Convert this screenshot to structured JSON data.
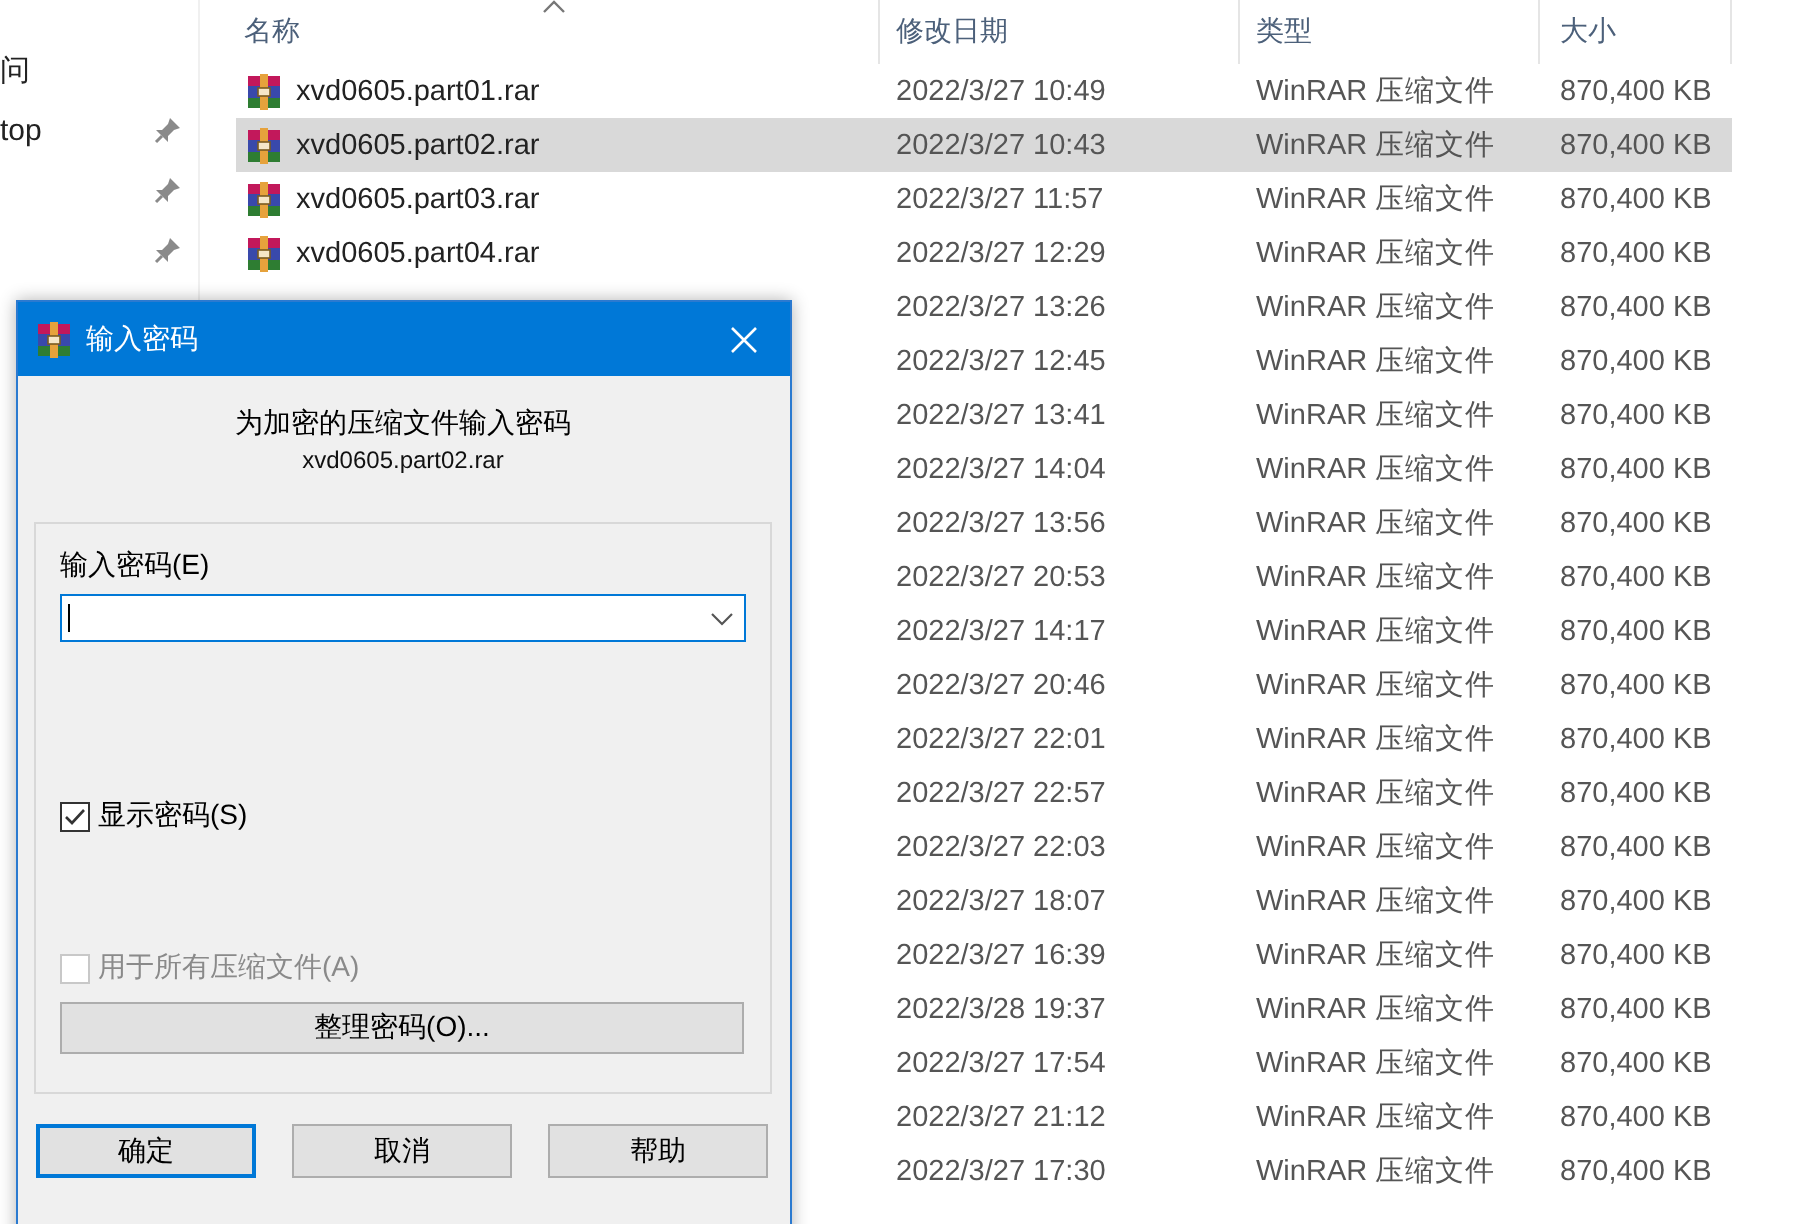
{
  "explorer": {
    "sidebar": {
      "items": [
        {
          "label": "问",
          "pinned": false
        },
        {
          "label": "top",
          "pinned": true
        },
        {
          "pinned": true
        },
        {
          "pinned": true
        }
      ]
    },
    "file_list": {
      "columns": [
        {
          "label": "名称",
          "sorted": true
        },
        {
          "label": "修改日期",
          "sorted": false
        },
        {
          "label": "类型",
          "sorted": false
        },
        {
          "label": "大小",
          "sorted": false
        }
      ],
      "rows": [
        {
          "name": "xvd0605.part01.rar",
          "date": "2022/3/27 10:49",
          "type": "WinRAR 压缩文件",
          "size": "870,400 KB",
          "selected": false
        },
        {
          "name": "xvd0605.part02.rar",
          "date": "2022/3/27 10:43",
          "type": "WinRAR 压缩文件",
          "size": "870,400 KB",
          "selected": true
        },
        {
          "name": "xvd0605.part03.rar",
          "date": "2022/3/27 11:57",
          "type": "WinRAR 压缩文件",
          "size": "870,400 KB",
          "selected": false
        },
        {
          "name": "xvd0605.part04.rar",
          "date": "2022/3/27 12:29",
          "type": "WinRAR 压缩文件",
          "size": "870,400 KB",
          "selected": false
        },
        {
          "date": "2022/3/27 13:26",
          "type": "WinRAR 压缩文件",
          "size": "870,400 KB",
          "selected": false
        },
        {
          "date": "2022/3/27 12:45",
          "type": "WinRAR 压缩文件",
          "size": "870,400 KB",
          "selected": false
        },
        {
          "date": "2022/3/27 13:41",
          "type": "WinRAR 压缩文件",
          "size": "870,400 KB",
          "selected": false
        },
        {
          "date": "2022/3/27 14:04",
          "type": "WinRAR 压缩文件",
          "size": "870,400 KB",
          "selected": false
        },
        {
          "date": "2022/3/27 13:56",
          "type": "WinRAR 压缩文件",
          "size": "870,400 KB",
          "selected": false
        },
        {
          "date": "2022/3/27 20:53",
          "type": "WinRAR 压缩文件",
          "size": "870,400 KB",
          "selected": false
        },
        {
          "date": "2022/3/27 14:17",
          "type": "WinRAR 压缩文件",
          "size": "870,400 KB",
          "selected": false
        },
        {
          "date": "2022/3/27 20:46",
          "type": "WinRAR 压缩文件",
          "size": "870,400 KB",
          "selected": false
        },
        {
          "date": "2022/3/27 22:01",
          "type": "WinRAR 压缩文件",
          "size": "870,400 KB",
          "selected": false
        },
        {
          "date": "2022/3/27 22:57",
          "type": "WinRAR 压缩文件",
          "size": "870,400 KB",
          "selected": false
        },
        {
          "date": "2022/3/27 22:03",
          "type": "WinRAR 压缩文件",
          "size": "870,400 KB",
          "selected": false
        },
        {
          "date": "2022/3/27 18:07",
          "type": "WinRAR 压缩文件",
          "size": "870,400 KB",
          "selected": false
        },
        {
          "date": "2022/3/27 16:39",
          "type": "WinRAR 压缩文件",
          "size": "870,400 KB",
          "selected": false
        },
        {
          "date": "2022/3/28 19:37",
          "type": "WinRAR 压缩文件",
          "size": "870,400 KB",
          "selected": false
        },
        {
          "date": "2022/3/27 17:54",
          "type": "WinRAR 压缩文件",
          "size": "870,400 KB",
          "selected": false
        },
        {
          "date": "2022/3/27 21:12",
          "type": "WinRAR 压缩文件",
          "size": "870,400 KB",
          "selected": false
        },
        {
          "date": "2022/3/27 17:30",
          "type": "WinRAR 压缩文件",
          "size": "870,400 KB",
          "selected": false
        }
      ]
    }
  },
  "dialog": {
    "title": "输入密码",
    "heading": "为加密的压缩文件输入密码",
    "archive": "xvd0605.part02.rar",
    "password_field": {
      "label": "输入密码(E)",
      "focused": true
    },
    "checkboxes": [
      {
        "label": "显示密码(S)",
        "checked": true,
        "disabled": false
      },
      {
        "label": "用于所有压缩文件(A)",
        "checked": false,
        "disabled": true
      }
    ],
    "organize_button": "整理密码(O)...",
    "buttons": [
      {
        "label": "确定",
        "default": true
      },
      {
        "label": "取消",
        "default": false
      },
      {
        "label": "帮助",
        "default": false
      }
    ]
  }
}
